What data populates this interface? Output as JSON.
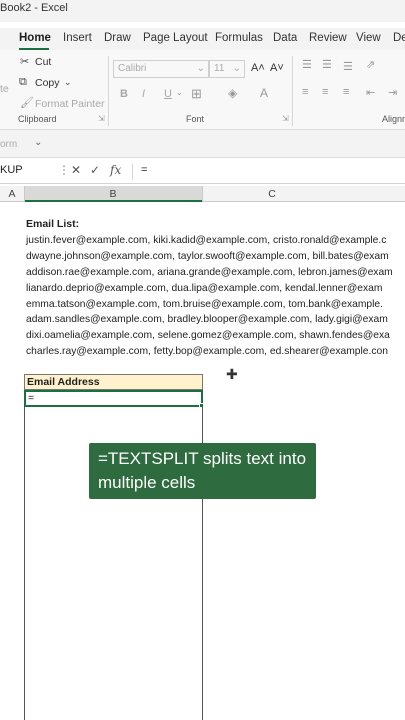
{
  "window": {
    "title": "Book2  -  Excel"
  },
  "tabs": [
    "Home",
    "Insert",
    "Draw",
    "Page Layout",
    "Formulas",
    "Data",
    "Review",
    "View",
    "De"
  ],
  "ribbon": {
    "clipboard": {
      "cut": "Cut",
      "copy": "Copy",
      "format_painter": "Format Painter",
      "paste_fragment": "te",
      "label": "Clipboard"
    },
    "font": {
      "font_name": "Calibri",
      "font_size": "11",
      "label": "Font",
      "bold": "B",
      "italic": "I",
      "underline": "U",
      "grow": "A˄",
      "shrink": "A˅"
    },
    "alignment": {
      "label": "Alignm"
    }
  },
  "quick_bar": {
    "text": "orm"
  },
  "formula_bar": {
    "name_box": "KUP",
    "fx": "fx",
    "formula": "="
  },
  "columns": [
    "A",
    "B",
    "C"
  ],
  "sheet": {
    "email_title": "Email List:",
    "emails": [
      "justin.fever@example.com, kiki.kadid@example.com, cristo.ronald@example.c",
      "dwayne.johnson@example.com, taylor.swooft@example.com, bill.bates@exam",
      "addison.rae@example.com, ariana.grande@example.com, lebron.james@exam",
      "lianardo.deprio@example.com, dua.lipa@example.com, kendal.lenner@exam",
      "emma.tatson@example.com, tom.bruise@example.com, tom.bank@example.",
      "adam.sandles@example.com, bradley.blooper@example.com, lady.gigi@exam",
      "dixi.oamelia@example.com, selene.gomez@example.com, shawn.fendes@exa",
      "charles.ray@example.com, fetty.bop@example.com, ed.shearer@example.con"
    ],
    "header_cell": "Email Address",
    "active_cell": "="
  },
  "caption": "=TEXTSPLIT splits text into multiple cells",
  "colors": {
    "accent": "#1d6f42",
    "caption_bg": "#2e6b3e",
    "header_fill": "#fff2cc"
  }
}
